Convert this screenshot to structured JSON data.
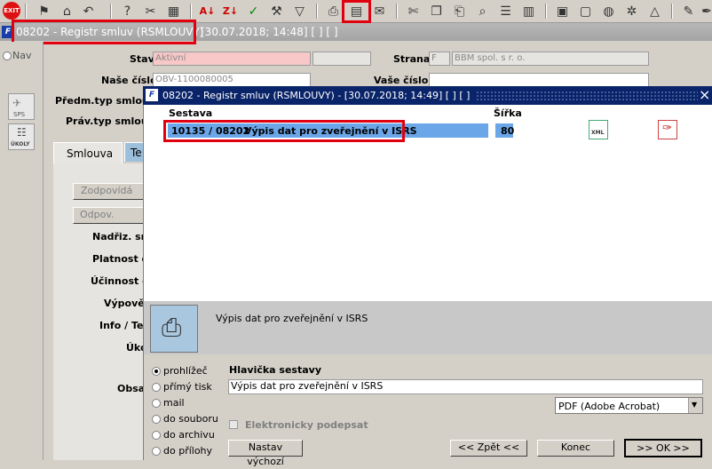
{
  "toolbar": {
    "exit_label": "EXIT",
    "icons": [
      "flag-icon",
      "home-icon",
      "back-icon",
      "help-icon",
      "clip-icon",
      "film-icon",
      "sort-asc-icon",
      "sort-desc-icon",
      "check-icon",
      "wrench-icon",
      "filter-icon",
      "print-icon",
      "report-icon",
      "mail-icon",
      "cut-icon",
      "copy-icon",
      "paste-icon",
      "find-icon",
      "list-icon",
      "grid-icon",
      "doc-icon",
      "save-icon",
      "globe-icon",
      "settings-icon",
      "chart-icon",
      "edit-icon",
      "pen-icon"
    ]
  },
  "back_window": {
    "title": "08202 - Registr smluv (RSMLOUVY)",
    "date": "[30.07.2018; 14:48]  [ ]  [ ]"
  },
  "left": {
    "nav_label": "Nav",
    "sps_label": "SPS",
    "ukoly_label": "ÚKOLY"
  },
  "form": {
    "stav_label": "Stav",
    "stav_value": "Aktivní",
    "strana_label": "Strana",
    "strana_code": "F",
    "strana_value": "BBM spol. s r. o.",
    "nase_cislo_label": "Naše číslo",
    "nase_cislo_value": "OBV-1100080005",
    "vase_cislo_label": "Vaše číslo",
    "predm_typ_label": "Předm.typ smlouv",
    "prav_typ_label": "Práv.typ smlouv",
    "tab_smlouva": "Smlouva",
    "tab_te": "Te",
    "zodpovida_btn": "Zodpovídá NS",
    "odpov_btn": "Odpov. osoby",
    "nadriz_label": "Nadřiz. sm",
    "platnost_label": "Platnost o",
    "ucinnost_label": "Účinnost o",
    "vypove_label": "Výpově",
    "info_label": "Info / Tex",
    "uko_label": "Úko",
    "obsa_label": "Obsa"
  },
  "dialog": {
    "title": "08202 - Registr smluv (RSMLOUVY) - [30.07.2018; 14:49]  [ ]  [ ]",
    "close": "×",
    "col_sestava": "Sestava",
    "col_sirka": "Šířka",
    "row": {
      "code": "10135 / 08202",
      "name": "Výpis dat pro zveřejnění v ISRS",
      "width": "80"
    },
    "xml_label": "XML",
    "preview_text": "Výpis dat pro zveřejnění v ISRS",
    "radio_options": [
      "prohlížeč",
      "přímý tisk",
      "mail",
      "do souboru",
      "do archivu",
      "do přílohy"
    ],
    "selected_radio": "prohlížeč",
    "hlavicka_label": "Hlavička sestavy",
    "hlavicka_value": "Výpis dat pro zveřejnění v ISRS",
    "format_value": "PDF (Adobe Acrobat)",
    "elektronicky_label": "Elektronicky podepsat",
    "nastav_btn": "Nastav výchozí",
    "zpet_btn": "<< Zpět <<",
    "konec_btn": "Konec",
    "ok_btn": ">> OK >>"
  },
  "colors": {
    "highlight": "#e00010",
    "title_blue": "#0a246a",
    "row_blue": "#6aa6e8"
  }
}
